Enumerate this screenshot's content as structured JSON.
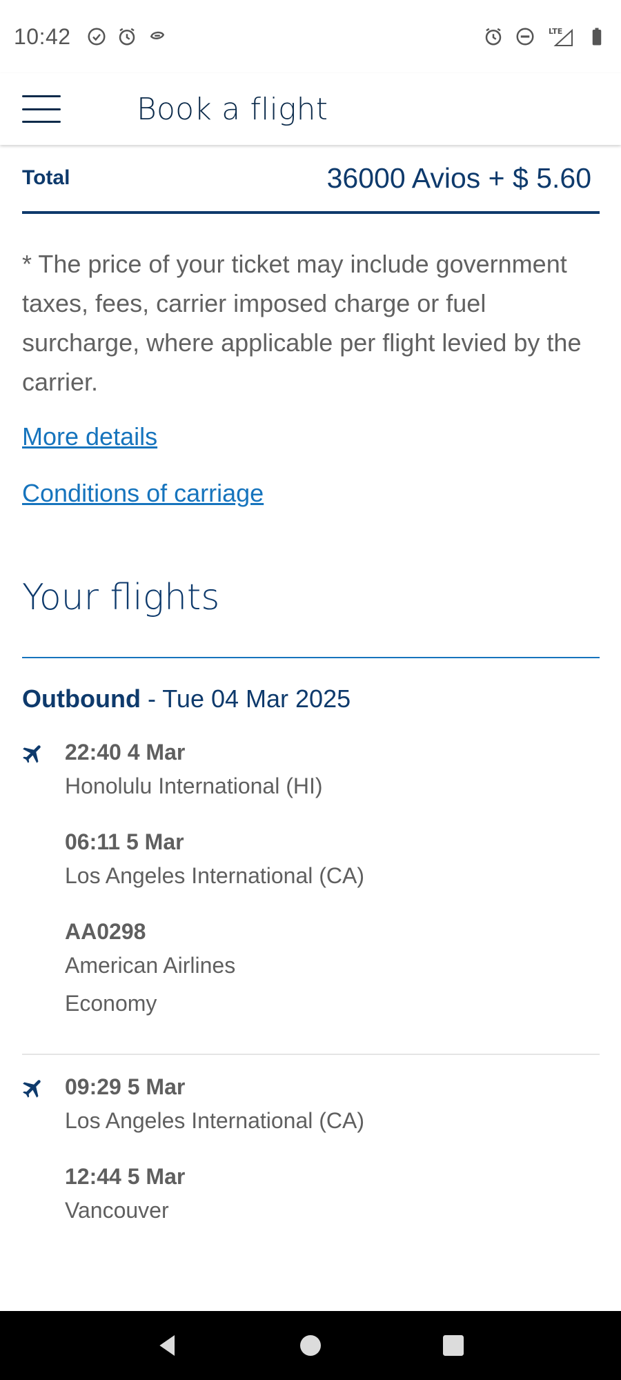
{
  "status_bar": {
    "time": "10:42",
    "left_icons": [
      "check-circle-icon",
      "alarm-icon",
      "app-notification-icon"
    ],
    "right_icons": [
      "alarm-icon",
      "do-not-disturb-icon",
      "lte-icon",
      "signal-icon",
      "battery-icon"
    ],
    "network": "LTE"
  },
  "app_bar": {
    "title": "Book a flight",
    "menu_icon": "hamburger-menu-icon"
  },
  "summary": {
    "total_label": "Total",
    "total_value": "36000 Avios +  $ 5.60",
    "disclaimer": "* The price of your ticket may include government taxes, fees, carrier imposed charge or fuel surcharge, where applicable per flight levied by the carrier.",
    "more_details_link": "More details",
    "conditions_link": "Conditions of carriage"
  },
  "flights": {
    "heading": "Your flights",
    "outbound_label": "Outbound",
    "outbound_date": " - Tue 04 Mar 2025",
    "segments": [
      {
        "departure_time": "22:40 4 Mar",
        "departure_place": "Honolulu International (HI)",
        "arrival_time": "06:11 5 Mar",
        "arrival_place": "Los Angeles International (CA)",
        "flight_number": "AA0298",
        "carrier": "American Airlines",
        "cabin": "Economy"
      },
      {
        "departure_time": "09:29 5 Mar",
        "departure_place": "Los Angeles International (CA)",
        "arrival_time": "12:44 5 Mar",
        "arrival_place": "Vancouver"
      }
    ]
  },
  "colors": {
    "brand_navy": "#0e3a6c",
    "link_blue": "#1674bd",
    "body_text": "#5f5f5f"
  }
}
